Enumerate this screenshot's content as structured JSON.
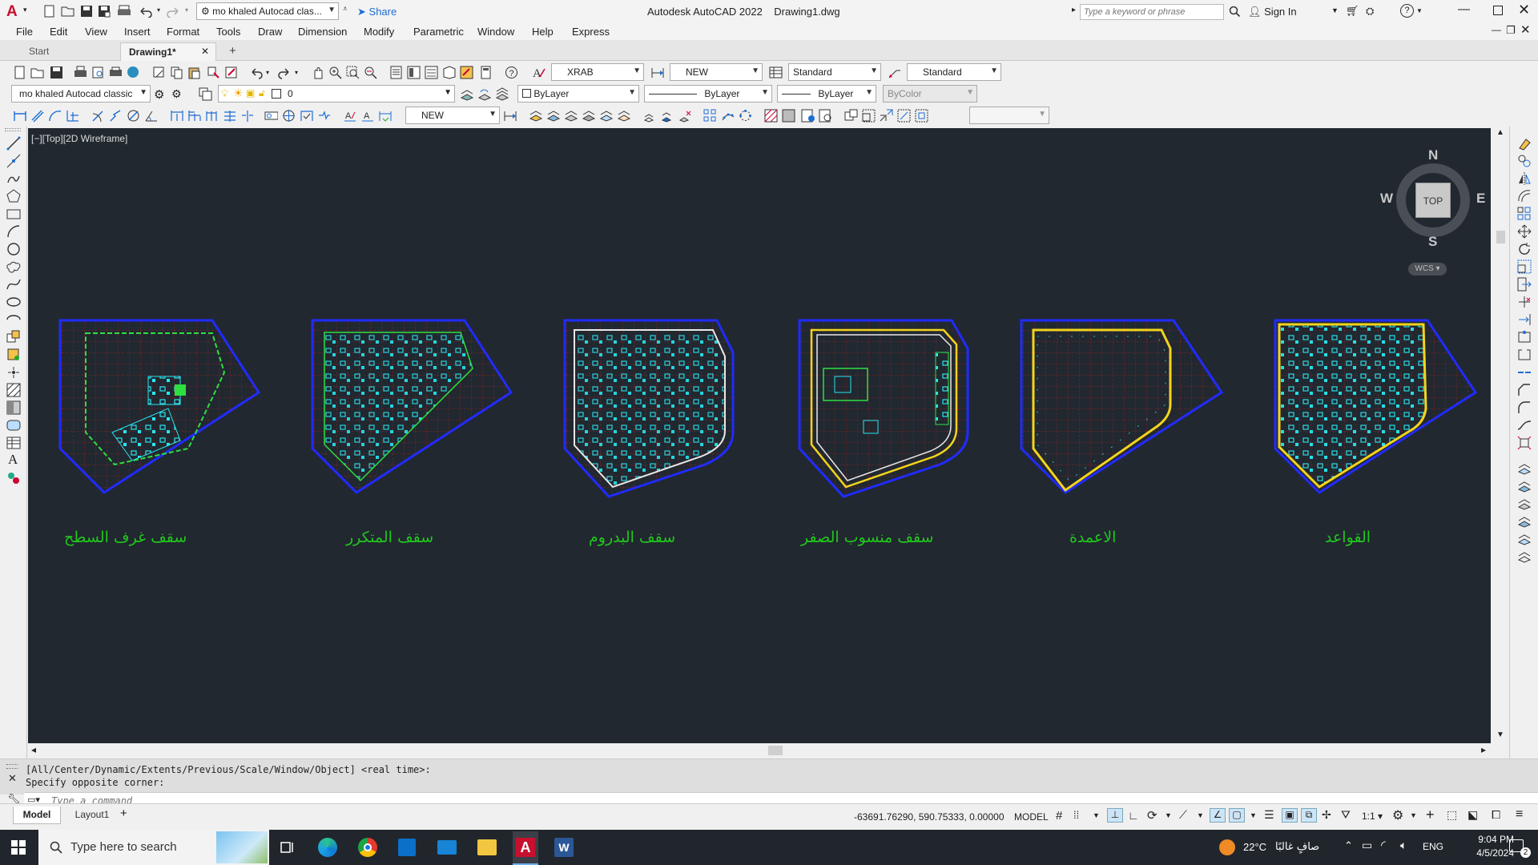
{
  "window": {
    "title": "Autodesk AutoCAD 2022",
    "file": "Drawing1.dwg",
    "workspace": "mo khaled Autocad clas...",
    "share_label": "Share",
    "search_placeholder": "Type a keyword or phrase",
    "signin_label": "Sign In"
  },
  "menu": [
    "File",
    "Edit",
    "View",
    "Insert",
    "Format",
    "Tools",
    "Draw",
    "Dimension",
    "Modify",
    "Parametric",
    "Window",
    "Help",
    "Express"
  ],
  "tabs": {
    "start": "Start",
    "drawing": "Drawing1*",
    "add": "+"
  },
  "toolbar": {
    "text_style": "XRAB",
    "dim_style": "NEW",
    "table_style": "Standard",
    "multileader_style": "Standard",
    "workspace_combo": "mo khaled Autocad classic",
    "layer": "0",
    "color": "ByLayer",
    "linetype": "ByLayer",
    "lineweight": "ByLayer",
    "plotstyle": "ByColor",
    "dim_style_2": "NEW"
  },
  "viewport": {
    "label": "[−][Top][2D Wireframe]",
    "viewcube": {
      "n": "N",
      "s": "S",
      "e": "E",
      "w": "W",
      "top": "TOP",
      "wcs": "WCS"
    },
    "drawing_labels": [
      "سقف غرف السطح",
      "سقف المتكرر",
      "سقف البدروم",
      "سقف منسوب الصفر",
      "الاعمدة",
      "القواعد"
    ]
  },
  "command": {
    "history_1": "[All/Center/Dynamic/Extents/Previous/Scale/Window/Object] <real time>:",
    "history_2": "Specify opposite corner:",
    "placeholder": "Type a command"
  },
  "layouts": {
    "model": "Model",
    "layout1": "Layout1",
    "add": "+"
  },
  "status": {
    "coords": "-63691.76290, 590.75333, 0.00000",
    "mode": "MODEL",
    "scale": "1:1"
  },
  "taskbar": {
    "search_placeholder": "Type here to search",
    "weather_temp": "22°C",
    "weather_text": "صافٍ غالبًا",
    "lang": "ENG",
    "time": "9:04 PM",
    "date": "4/5/2024",
    "notif_count": "2"
  },
  "colors": {
    "viewport_bg": "#212830",
    "label_green": "#21c81c",
    "autocad_red": "#c8102e"
  }
}
